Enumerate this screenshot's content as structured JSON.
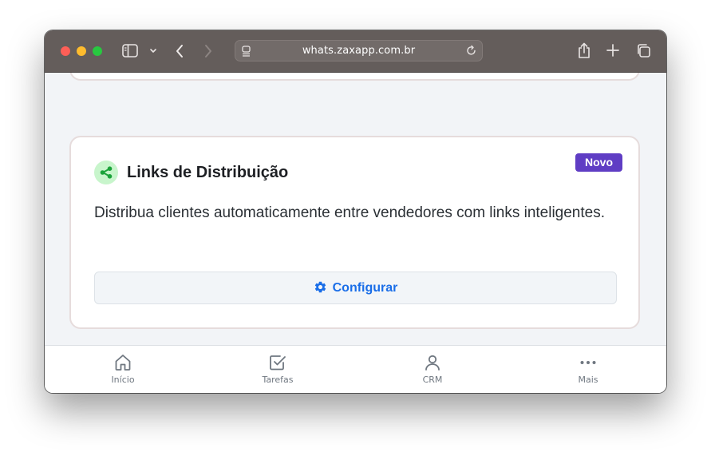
{
  "browser": {
    "url": "whats.zaxapp.com.br",
    "icons": [
      "sidebar-icon",
      "chevron-down-icon",
      "back-icon",
      "forward-icon",
      "page-icon",
      "reload-icon",
      "share-icon",
      "plus-icon",
      "tabs-icon"
    ]
  },
  "card": {
    "badge": "Novo",
    "title": "Links de Distribuição",
    "description": "Distribua clientes automaticamente entre vendedores com links inteligentes.",
    "button_label": "Configurar",
    "icon": "share-nodes-icon",
    "icon_color": "#1aa33a",
    "badge_color": "#5f3dc4",
    "button_color": "#1a6ee8"
  },
  "next_card": {
    "badge": ""
  },
  "bottom_nav": {
    "items": [
      {
        "label": "Início",
        "icon": "home-icon"
      },
      {
        "label": "Tarefas",
        "icon": "checkbox-icon"
      },
      {
        "label": "CRM",
        "icon": "user-icon"
      },
      {
        "label": "Mais",
        "icon": "more-icon"
      }
    ]
  }
}
